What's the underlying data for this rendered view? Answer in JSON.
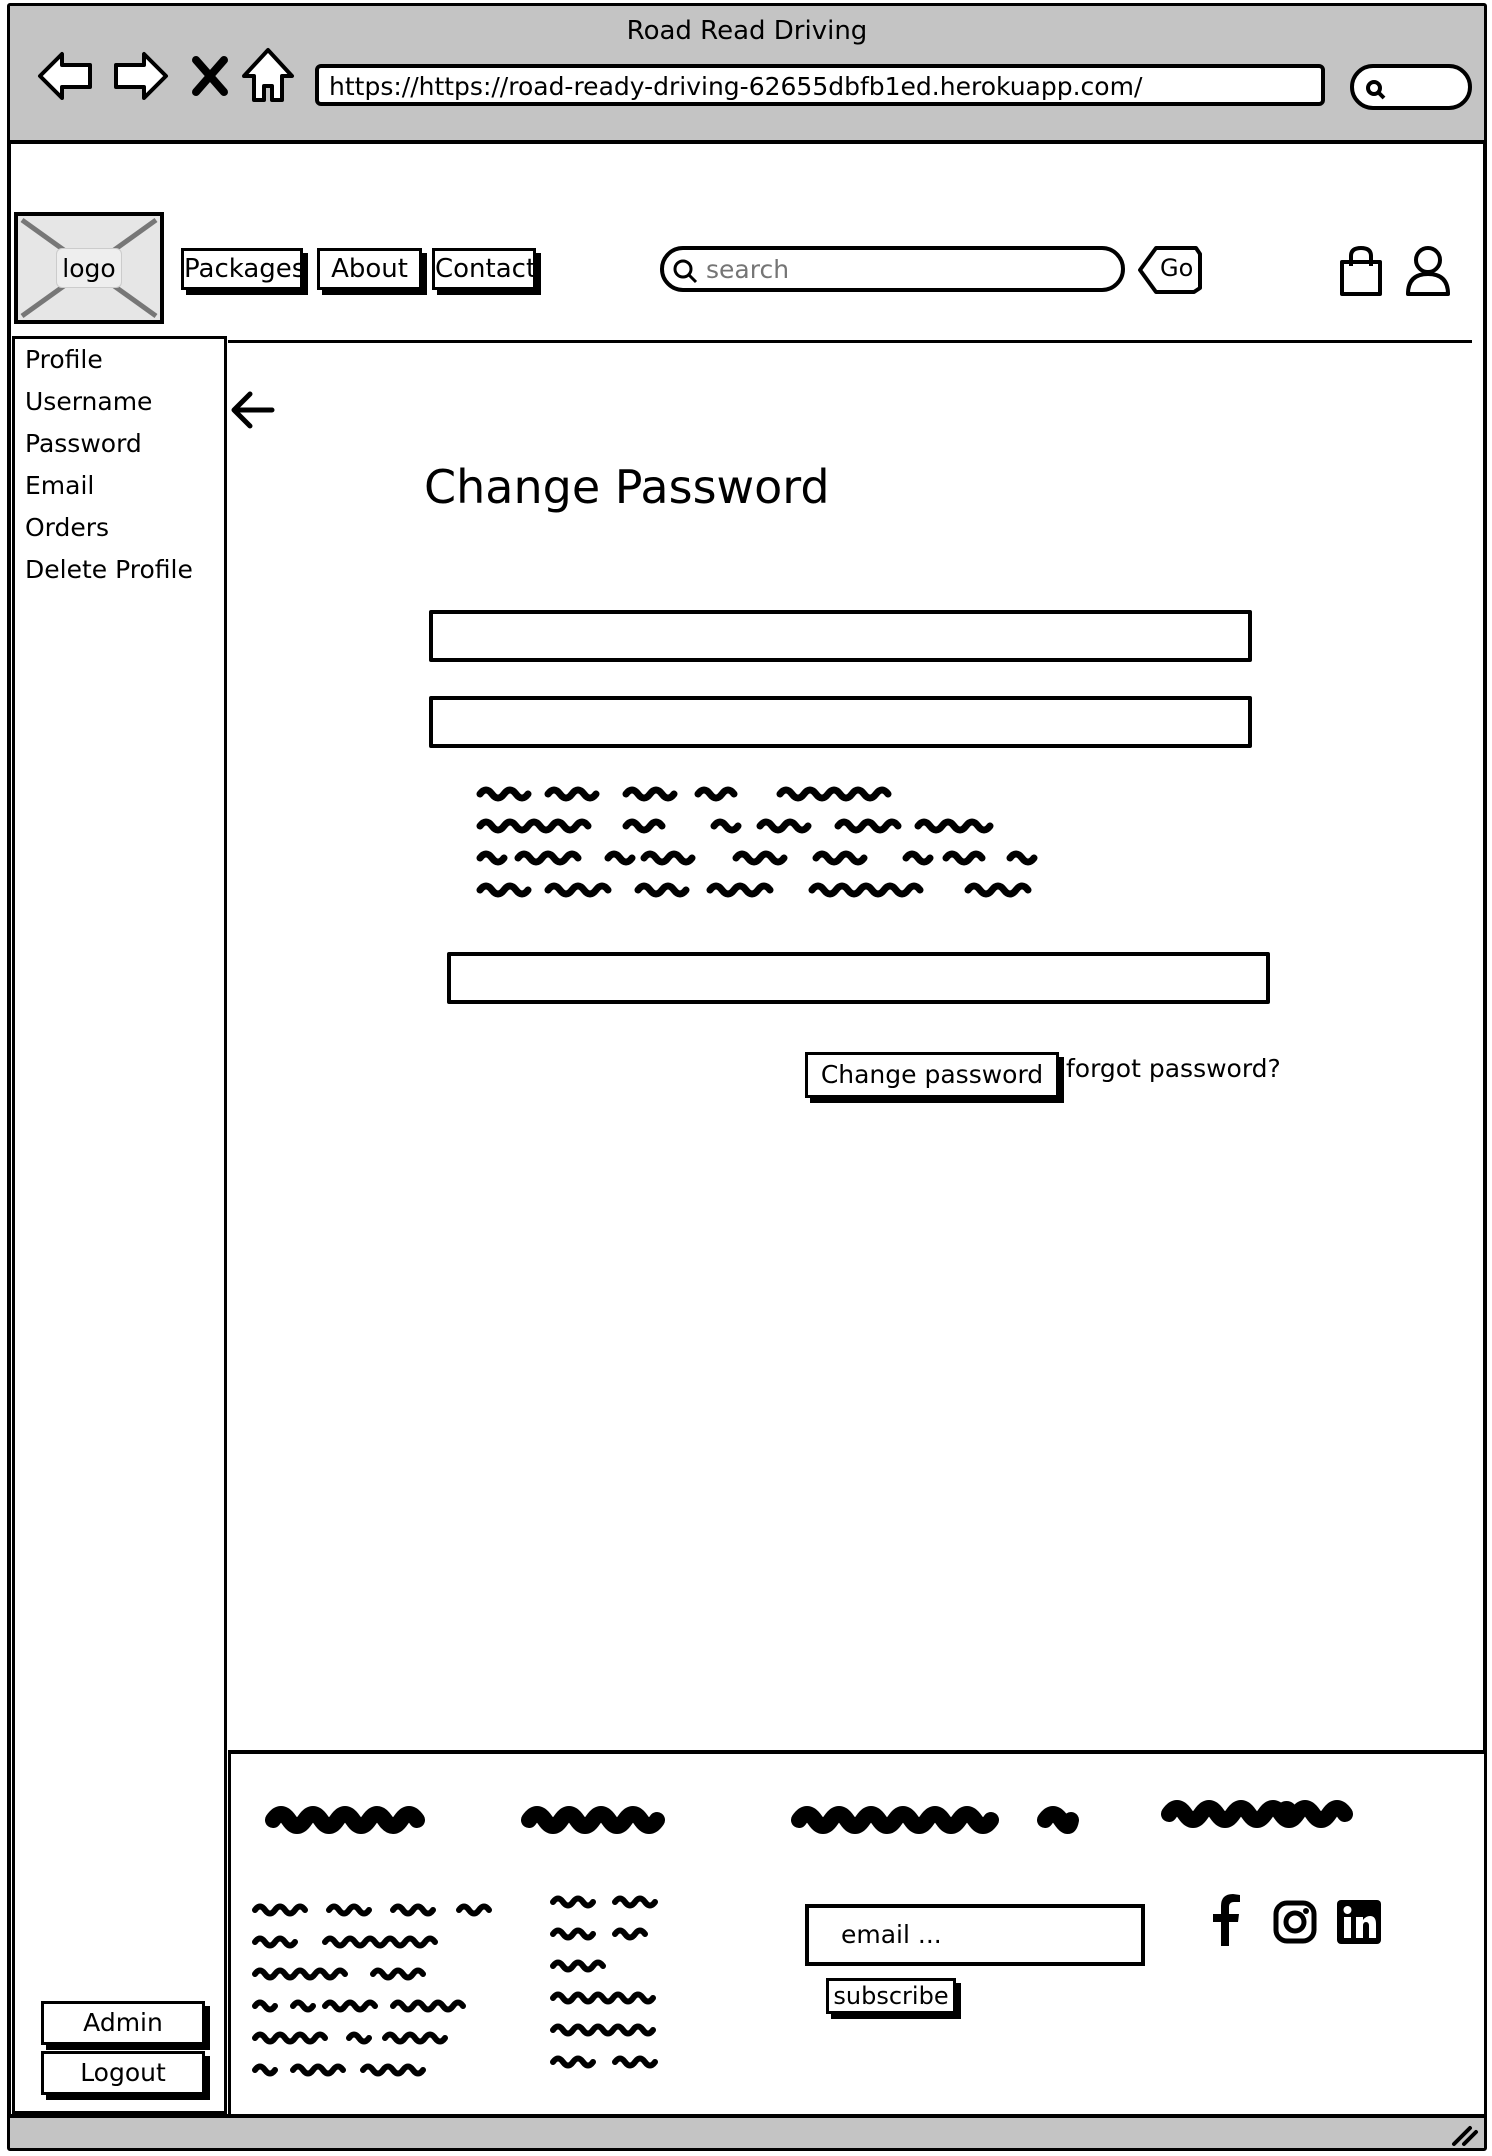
{
  "window": {
    "title": "Road Read Driving",
    "url": "https://https://road-ready-driving-62655dbfb1ed.herokuapp.com/"
  },
  "header": {
    "logo_label": "logo",
    "nav": [
      {
        "label": "Packages"
      },
      {
        "label": "About"
      },
      {
        "label": "Contact"
      }
    ],
    "search_placeholder": "search",
    "go_label": "Go"
  },
  "sidebar": {
    "items": [
      {
        "label": "Profile"
      },
      {
        "label": "Username"
      },
      {
        "label": "Password"
      },
      {
        "label": "Email"
      },
      {
        "label": "Orders"
      },
      {
        "label": "Delete Profile"
      }
    ],
    "admin_label": "Admin",
    "logout_label": "Logout"
  },
  "main": {
    "title": "Change Password",
    "submit_label": "Change password",
    "forgot_label": "forgot password?"
  },
  "footer": {
    "email_placeholder": "email     ...",
    "subscribe_label": "subscribe",
    "social": [
      "facebook-icon",
      "instagram-icon",
      "linkedin-icon"
    ]
  }
}
